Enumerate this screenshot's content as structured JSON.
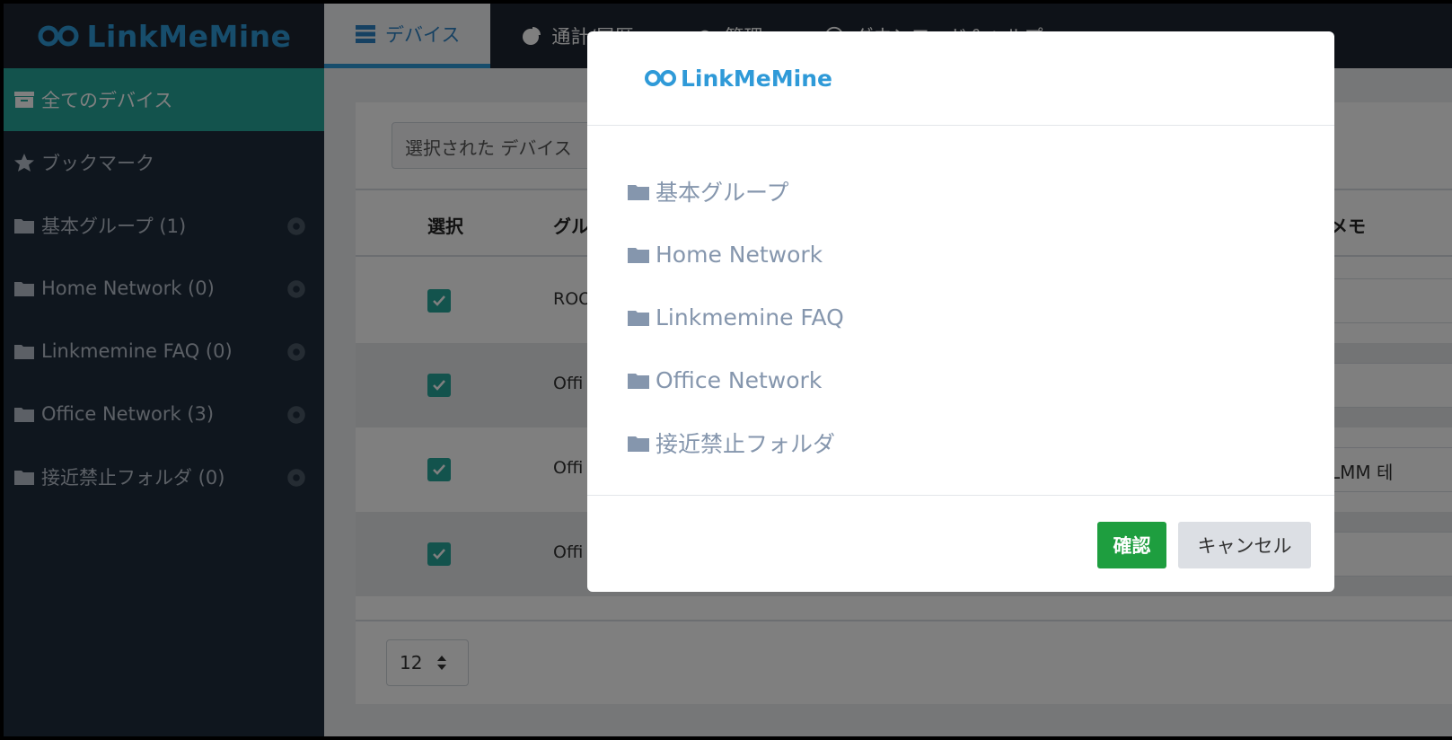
{
  "app": {
    "brand": "LinkMeMine"
  },
  "nav": {
    "tabs": [
      {
        "label": "デバイス",
        "icon": "server-icon",
        "active": true
      },
      {
        "label": "通計/履歴",
        "icon": "pie-chart-icon"
      },
      {
        "label": "管理",
        "icon": "gear-icon"
      },
      {
        "label": "ダウンロード＆ヘルプ",
        "icon": "help-icon"
      }
    ]
  },
  "sidebar": {
    "items": [
      {
        "label": "全てのデバイス",
        "icon": "archive-icon",
        "active": true
      },
      {
        "label": "ブックマーク",
        "icon": "star-icon"
      },
      {
        "label": "基本グループ (1)",
        "icon": "folder-icon",
        "settings": true
      },
      {
        "label": "Home Network (0)",
        "icon": "folder-icon",
        "settings": true
      },
      {
        "label": "Linkmemine FAQ (0)",
        "icon": "folder-icon",
        "settings": true
      },
      {
        "label": "Office Network (3)",
        "icon": "folder-icon",
        "settings": true
      },
      {
        "label": "接近禁止フォルダ (0)",
        "icon": "folder-icon",
        "settings": true
      }
    ]
  },
  "main": {
    "selection_box": "選択された デバイス",
    "table": {
      "headers": [
        "選択",
        "グル",
        "メモ"
      ],
      "rows": [
        {
          "selected": true,
          "name": "ROO"
        },
        {
          "selected": true,
          "name": "Offi"
        },
        {
          "selected": true,
          "name": "Offi",
          "memo": "LMM 테"
        },
        {
          "selected": true,
          "name": "Offi"
        }
      ]
    },
    "page_size": "12"
  },
  "modal": {
    "logo": "LinkMeMine",
    "groups": [
      "基本グループ",
      "Home Network",
      "Linkmemine FAQ",
      "Office Network",
      "接近禁止フォルダ"
    ],
    "confirm_label": "確認",
    "cancel_label": "キャンセル"
  },
  "colors": {
    "topbar": "#1d2530",
    "sidebar": "#1f2d3d",
    "accent_teal": "#26a69a",
    "brand_blue": "#2f9ad8",
    "confirm_green": "#1e9e3f",
    "group_text": "#8596ad"
  }
}
